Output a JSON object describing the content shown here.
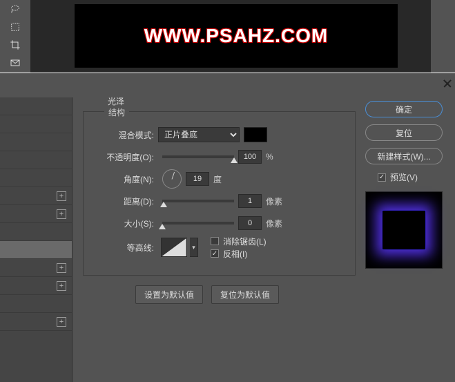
{
  "banner": {
    "text": "WWW.PSAHZ.COM"
  },
  "dialog": {
    "section_title": "光泽",
    "fieldset_title": "结构",
    "labels": {
      "blend_mode": "混合模式:",
      "opacity": "不透明度(O):",
      "angle": "角度(N):",
      "distance": "距离(D):",
      "size": "大小(S):",
      "contour": "等高线:"
    },
    "blend_mode_value": "正片叠底",
    "opacity_value": "100",
    "opacity_unit": "%",
    "angle_value": "19",
    "angle_unit": "度",
    "distance_value": "1",
    "distance_unit": "像素",
    "size_value": "0",
    "size_unit": "像素",
    "antialias_label": "消除锯齿(L)",
    "invert_label": "反相(I)",
    "set_default": "设置为默认值",
    "reset_default": "复位为默认值"
  },
  "right": {
    "ok": "确定",
    "cancel": "复位",
    "new_style": "新建样式(W)...",
    "preview": "预览(V)"
  }
}
